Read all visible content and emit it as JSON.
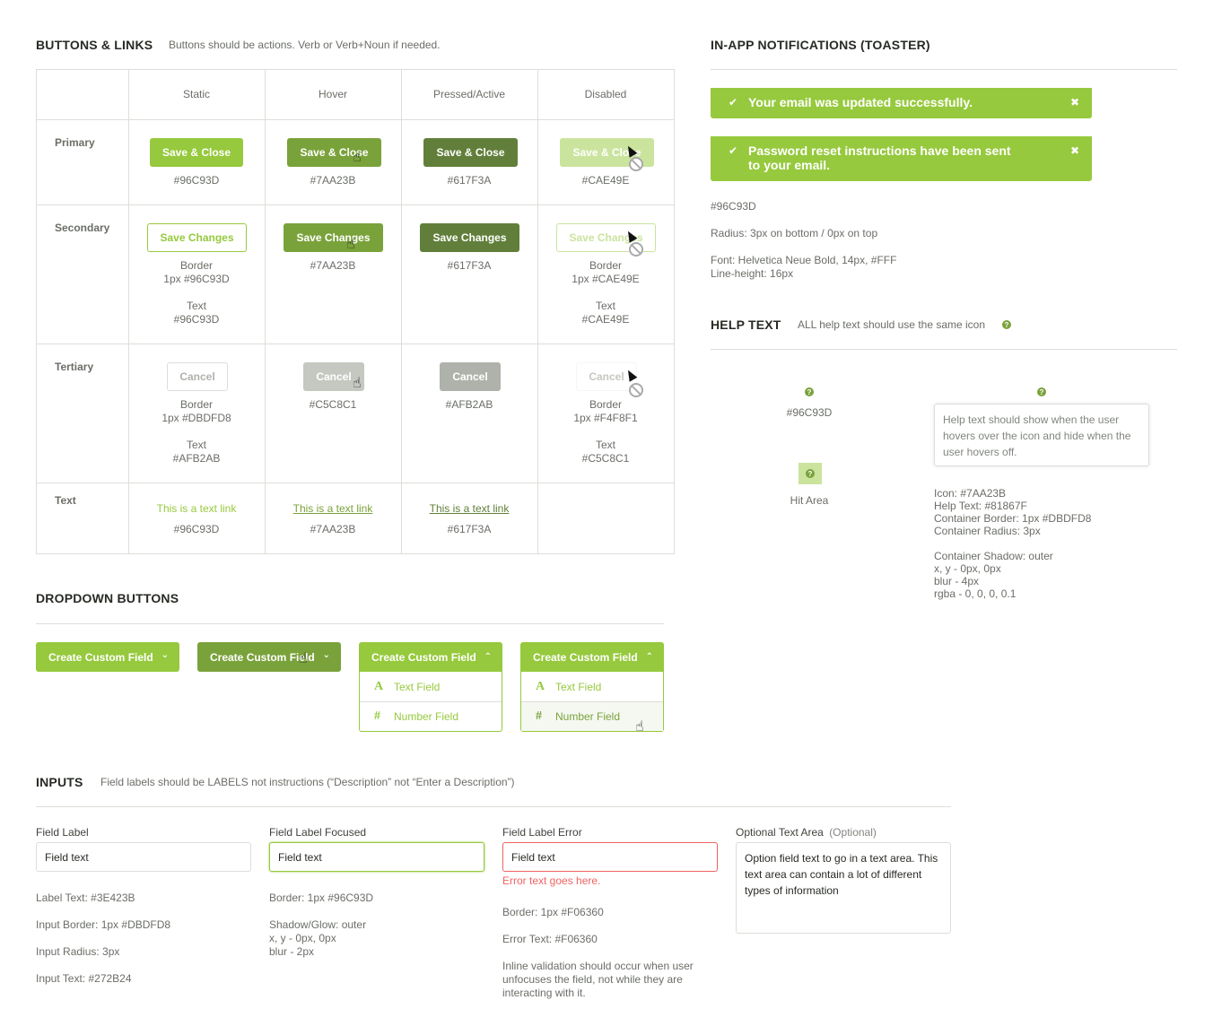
{
  "buttons": {
    "title": "BUTTONS & LINKS",
    "subtitle": "Buttons should be actions. Verb or Verb+Noun if needed.",
    "columns": [
      "Static",
      "Hover",
      "Pressed/Active",
      "Disabled"
    ],
    "rows": {
      "primary": "Primary",
      "secondary": "Secondary",
      "tertiary": "Tertiary",
      "text": "Text"
    },
    "primary": {
      "label": "Save & Close",
      "static_color": "#96C93D",
      "hover_color": "#7AA23B",
      "pressed_color": "#617F3A",
      "disabled_color": "#CAE49E"
    },
    "secondary": {
      "label": "Save Changes",
      "static_border_title": "Border",
      "static_border": "1px #96C93D",
      "static_text_title": "Text",
      "static_text": "#96C93D",
      "hover_color": "#7AA23B",
      "pressed_color": "#617F3A",
      "disabled_border_title": "Border",
      "disabled_border": "1px #CAE49E",
      "disabled_text_title": "Text",
      "disabled_text": "#CAE49E"
    },
    "tertiary": {
      "label": "Cancel",
      "static_border_title": "Border",
      "static_border": "1px #DBDFD8",
      "static_text_title": "Text",
      "static_text": "#AFB2AB",
      "hover_color": "#C5C8C1",
      "pressed_color": "#AFB2AB",
      "disabled_border_title": "Border",
      "disabled_border": "1px #F4F8F1",
      "disabled_text_title": "Text",
      "disabled_text": "#C5C8C1"
    },
    "text": {
      "label": "This is a text link",
      "static_color": "#96C93D",
      "hover_color": "#7AA23B",
      "pressed_color": "#617F3A"
    }
  },
  "dropdown": {
    "title": "DROPDOWN BUTTONS",
    "label": "Create Custom Field",
    "items": [
      {
        "icon": "A",
        "label": "Text Field"
      },
      {
        "icon": "#",
        "label": "Number Field"
      }
    ]
  },
  "inputs": {
    "title": "INPUTS",
    "subtitle": "Field labels should be LABELS not instructions (“Description” not “Enter a Description”)",
    "normal": {
      "label": "Field Label",
      "value": "Field text",
      "notes": [
        "Label Text: #3E423B",
        "Input Border: 1px #DBDFD8",
        "Input Radius: 3px",
        "Input Text: #272B24"
      ]
    },
    "focused": {
      "label": "Field Label Focused",
      "value": "Field text",
      "note1": "Border: 1px #96C93D",
      "note2_lines": [
        "Shadow/Glow: outer",
        "x, y - 0px, 0px",
        "blur - 2px"
      ]
    },
    "error": {
      "label": "Field Label Error",
      "value": "Field text",
      "error_text": "Error text goes here.",
      "note1": "Border: 1px #F06360",
      "note2": "Error Text: #F06360",
      "note3_lines": [
        "Inline validation should occur when user",
        "unfocuses the field, not while they are",
        "interacting with it."
      ]
    },
    "textarea": {
      "label": "Optional Text Area",
      "optional": "(Optional)",
      "value": "Option field text to go in a text area. This text area can contain a lot of different types of information"
    }
  },
  "toaster": {
    "title": "IN-APP NOTIFICATIONS (TOASTER)",
    "messages": [
      "Your email was updated successfully.",
      "Password reset instructions have been sent to your email."
    ],
    "color": "#96C93D",
    "radius_note": "Radius: 3px on bottom / 0px on top",
    "font_note_lines": [
      "Font: Helvetica Neue Bold, 14px, #FFF",
      "Line-height: 16px"
    ]
  },
  "help": {
    "title": "HELP TEXT",
    "subtitle": "ALL help text should use the same icon",
    "icon_color": "#96C93D",
    "hit_area": "Hit Area",
    "tooltip": "Help text should show when the user hovers over the icon and hide when the user hovers off.",
    "notes1": [
      "Icon: #7AA23B",
      "Help Text: #81867F",
      "Container Border: 1px #DBDFD8",
      "Container Radius: 3px"
    ],
    "notes2": [
      "Container Shadow: outer",
      "x, y - 0px, 0px",
      "blur - 4px",
      "rgba - 0, 0, 0, 0.1"
    ]
  }
}
